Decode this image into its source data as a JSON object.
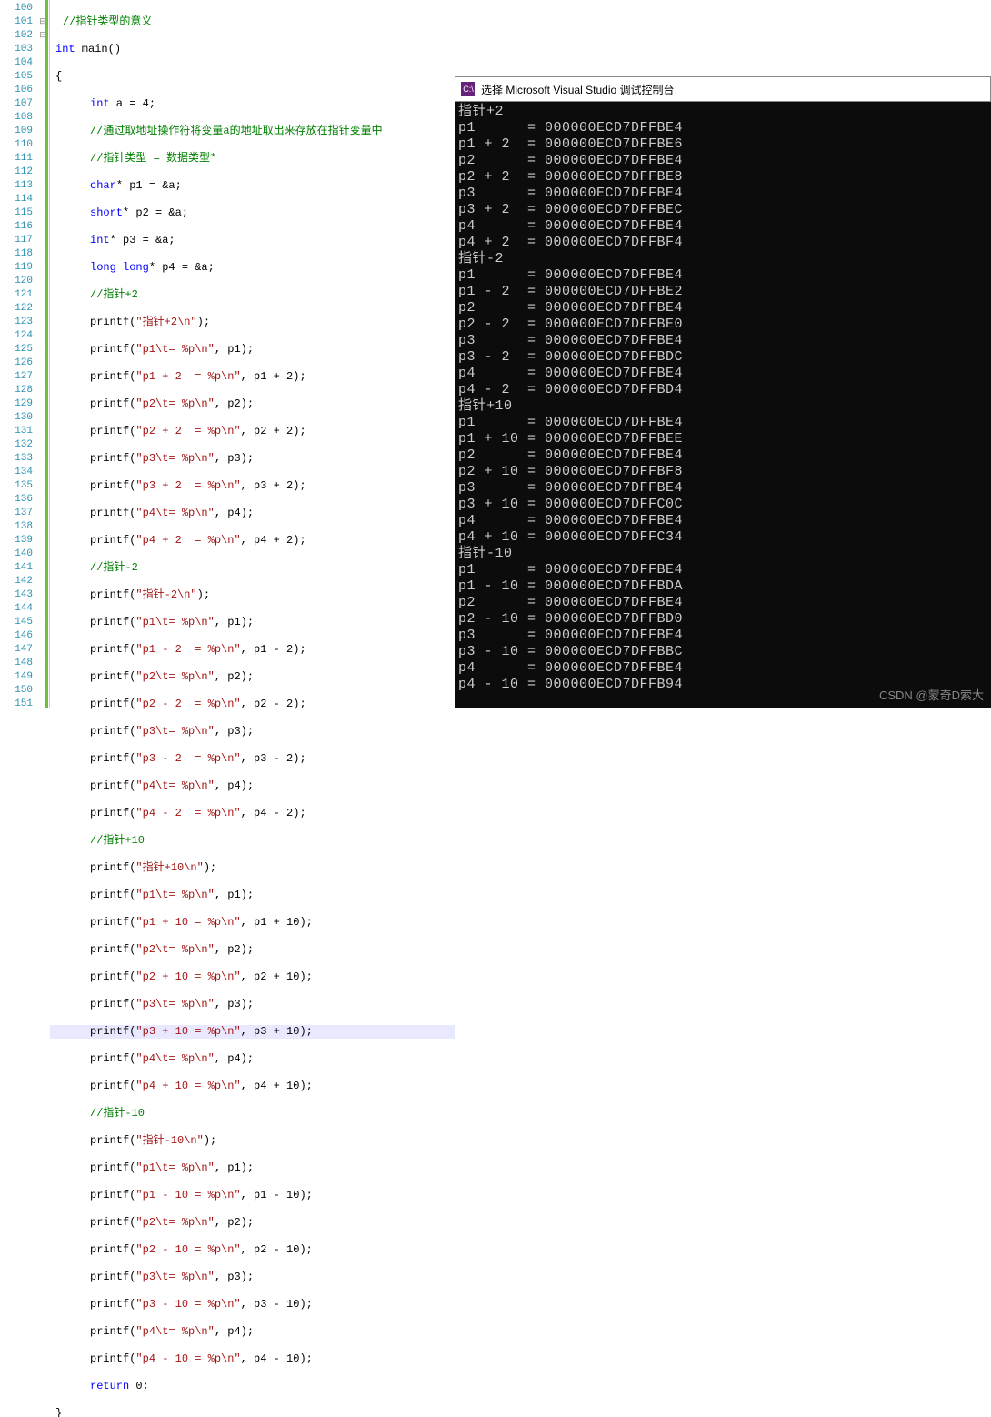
{
  "lines": [
    100,
    101,
    102,
    103,
    104,
    105,
    106,
    107,
    108,
    109,
    110,
    111,
    112,
    113,
    114,
    115,
    116,
    117,
    118,
    119,
    120,
    121,
    122,
    123,
    124,
    125,
    126,
    127,
    128,
    129,
    130,
    131,
    132,
    133,
    134,
    135,
    136,
    137,
    138,
    139,
    140,
    141,
    142,
    143,
    144,
    145,
    146,
    147,
    148,
    149,
    150,
    151
  ],
  "code": {
    "c100": "//指针类型的意义",
    "c101a": "int",
    "c101b": " main()",
    "c102": "{",
    "c103a": "int",
    "c103b": " a = 4;",
    "c104": "//通过取地址操作符将变量a的地址取出来存放在指针变量中",
    "c105": "//指针类型 = 数据类型*",
    "c106a": "char",
    "c106b": "* p1 = &a;",
    "c107a": "short",
    "c107b": "* p2 = &a;",
    "c108a": "int",
    "c108b": "* p3 = &a;",
    "c109a": "long long",
    "c109b": "* p4 = &a;",
    "c110": "//指针+2",
    "c111a": "printf(",
    "c111s": "\"指针+2\\n\"",
    "c111e": ");",
    "c112a": "printf(",
    "c112s": "\"p1\\t= %p\\n\"",
    "c112e": ", p1);",
    "c113a": "printf(",
    "c113s": "\"p1 + 2  = %p\\n\"",
    "c113e": ", p1 + 2);",
    "c114a": "printf(",
    "c114s": "\"p2\\t= %p\\n\"",
    "c114e": ", p2);",
    "c115a": "printf(",
    "c115s": "\"p2 + 2  = %p\\n\"",
    "c115e": ", p2 + 2);",
    "c116a": "printf(",
    "c116s": "\"p3\\t= %p\\n\"",
    "c116e": ", p3);",
    "c117a": "printf(",
    "c117s": "\"p3 + 2  = %p\\n\"",
    "c117e": ", p3 + 2);",
    "c118a": "printf(",
    "c118s": "\"p4\\t= %p\\n\"",
    "c118e": ", p4);",
    "c119a": "printf(",
    "c119s": "\"p4 + 2  = %p\\n\"",
    "c119e": ", p4 + 2);",
    "c120": "//指针-2",
    "c121a": "printf(",
    "c121s": "\"指针-2\\n\"",
    "c121e": ");",
    "c122a": "printf(",
    "c122s": "\"p1\\t= %p\\n\"",
    "c122e": ", p1);",
    "c123a": "printf(",
    "c123s": "\"p1 - 2  = %p\\n\"",
    "c123e": ", p1 - 2);",
    "c124a": "printf(",
    "c124s": "\"p2\\t= %p\\n\"",
    "c124e": ", p2);",
    "c125a": "printf(",
    "c125s": "\"p2 - 2  = %p\\n\"",
    "c125e": ", p2 - 2);",
    "c126a": "printf(",
    "c126s": "\"p3\\t= %p\\n\"",
    "c126e": ", p3);",
    "c127a": "printf(",
    "c127s": "\"p3 - 2  = %p\\n\"",
    "c127e": ", p3 - 2);",
    "c128a": "printf(",
    "c128s": "\"p4\\t= %p\\n\"",
    "c128e": ", p4);",
    "c129a": "printf(",
    "c129s": "\"p4 - 2  = %p\\n\"",
    "c129e": ", p4 - 2);",
    "c130": "//指针+10",
    "c131a": "printf(",
    "c131s": "\"指针+10\\n\"",
    "c131e": ");",
    "c132a": "printf(",
    "c132s": "\"p1\\t= %p\\n\"",
    "c132e": ", p1);",
    "c133a": "printf(",
    "c133s": "\"p1 + 10 = %p\\n\"",
    "c133e": ", p1 + 10);",
    "c134a": "printf(",
    "c134s": "\"p2\\t= %p\\n\"",
    "c134e": ", p2);",
    "c135a": "printf(",
    "c135s": "\"p2 + 10 = %p\\n\"",
    "c135e": ", p2 + 10);",
    "c136a": "printf(",
    "c136s": "\"p3\\t= %p\\n\"",
    "c136e": ", p3);",
    "c137a": "printf(",
    "c137s": "\"p3 + 10 = %p\\n\"",
    "c137e": ", p3 + 10);",
    "c138a": "printf(",
    "c138s": "\"p4\\t= %p\\n\"",
    "c138e": ", p4);",
    "c139a": "printf(",
    "c139s": "\"p4 + 10 = %p\\n\"",
    "c139e": ", p4 + 10);",
    "c140": "//指针-10",
    "c141a": "printf(",
    "c141s": "\"指针-10\\n\"",
    "c141e": ");",
    "c142a": "printf(",
    "c142s": "\"p1\\t= %p\\n\"",
    "c142e": ", p1);",
    "c143a": "printf(",
    "c143s": "\"p1 - 10 = %p\\n\"",
    "c143e": ", p1 - 10);",
    "c144a": "printf(",
    "c144s": "\"p2\\t= %p\\n\"",
    "c144e": ", p2);",
    "c145a": "printf(",
    "c145s": "\"p2 - 10 = %p\\n\"",
    "c145e": ", p2 - 10);",
    "c146a": "printf(",
    "c146s": "\"p3\\t= %p\\n\"",
    "c146e": ", p3);",
    "c147a": "printf(",
    "c147s": "\"p3 - 10 = %p\\n\"",
    "c147e": ", p3 - 10);",
    "c148a": "printf(",
    "c148s": "\"p4\\t= %p\\n\"",
    "c148e": ", p4);",
    "c149a": "printf(",
    "c149s": "\"p4 - 10 = %p\\n\"",
    "c149e": ", p4 - 10);",
    "c150a": "return",
    "c150b": " 0;",
    "c151": "}"
  },
  "console": {
    "title": "选择 Microsoft Visual Studio 调试控制台",
    "icon": "C:\\",
    "out": "指针+2\np1      = 000000ECD7DFFBE4\np1 + 2  = 000000ECD7DFFBE6\np2      = 000000ECD7DFFBE4\np2 + 2  = 000000ECD7DFFBE8\np3      = 000000ECD7DFFBE4\np3 + 2  = 000000ECD7DFFBEC\np4      = 000000ECD7DFFBE4\np4 + 2  = 000000ECD7DFFBF4\n指针-2\np1      = 000000ECD7DFFBE4\np1 - 2  = 000000ECD7DFFBE2\np2      = 000000ECD7DFFBE4\np2 - 2  = 000000ECD7DFFBE0\np3      = 000000ECD7DFFBE4\np3 - 2  = 000000ECD7DFFBDC\np4      = 000000ECD7DFFBE4\np4 - 2  = 000000ECD7DFFBD4\n指针+10\np1      = 000000ECD7DFFBE4\np1 + 10 = 000000ECD7DFFBEE\np2      = 000000ECD7DFFBE4\np2 + 10 = 000000ECD7DFFBF8\np3      = 000000ECD7DFFBE4\np3 + 10 = 000000ECD7DFFC0C\np4      = 000000ECD7DFFBE4\np4 + 10 = 000000ECD7DFFC34\n指针-10\np1      = 000000ECD7DFFBE4\np1 - 10 = 000000ECD7DFFBDA\np2      = 000000ECD7DFFBE4\np2 - 10 = 000000ECD7DFFBD0\np3      = 000000ECD7DFFBE4\np3 - 10 = 000000ECD7DFFBBC\np4      = 000000ECD7DFFBE4\np4 - 10 = 000000ECD7DFFB94"
  },
  "watermark": "CSDN @蒙奇D索大"
}
